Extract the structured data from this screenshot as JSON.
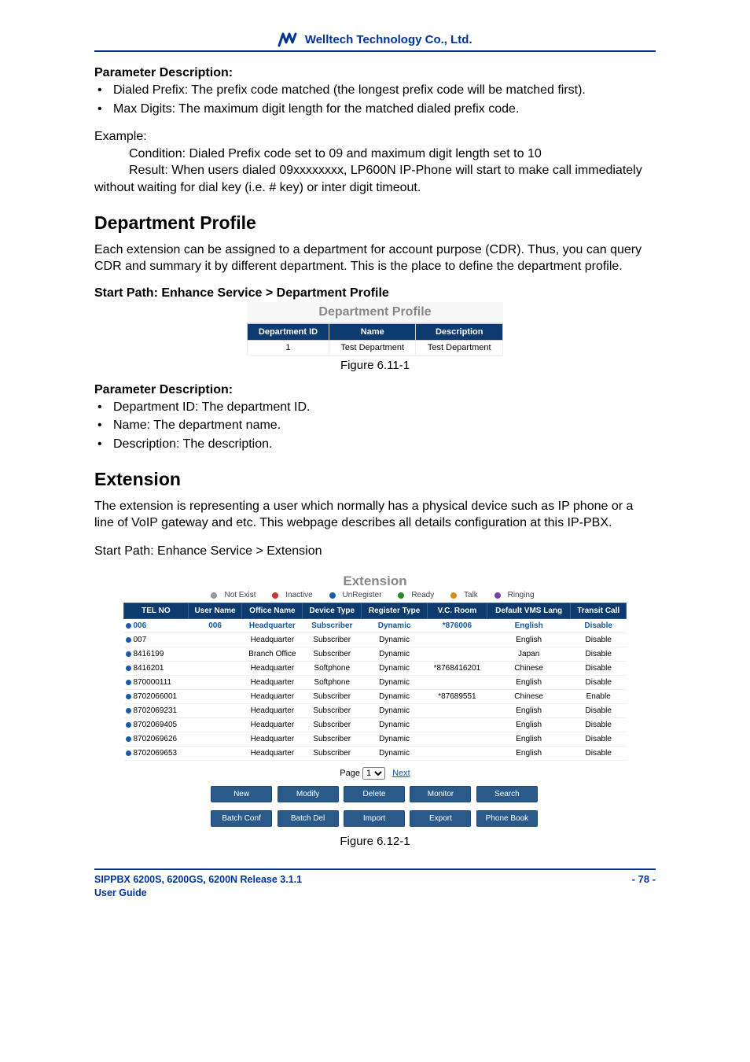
{
  "company": "Welltech Technology Co., Ltd.",
  "param_desc_head": "Parameter Description:",
  "param_desc1": [
    "Dialed Prefix: The prefix code matched (the longest prefix code will be matched first).",
    "Max Digits: The maximum digit length for the matched dialed prefix code."
  ],
  "example_head": "Example:",
  "example_line1": "Condition: Dialed Prefix code set to 09 and maximum digit length set to 10",
  "example_line2": "Result: When users dialed 09xxxxxxxx, LP600N IP-Phone will start to make call immediately without waiting for dial key (i.e. # key) or inter digit timeout.",
  "dept_profile_heading": "Department Profile",
  "dept_profile_text": "Each extension can be assigned to a department for account purpose (CDR). Thus, you can query CDR and summary it by different department. This is the place to define the department profile.",
  "dept_profile_path": "Start Path: Enhance Service > Department Profile",
  "dept_panel_title": "Department Profile",
  "dept_cols": [
    "Department ID",
    "Name",
    "Description"
  ],
  "dept_row": {
    "id": "1",
    "name": "Test Department",
    "desc": "Test Department"
  },
  "fig_611": "Figure 6.11-1",
  "param_desc2": [
    "Department ID: The department ID.",
    "Name: The department name.",
    "Description: The description."
  ],
  "ext_heading": "Extension",
  "ext_text": "The extension is representing a user which normally has a physical device such as IP phone or a line of VoIP gateway and etc. This webpage describes all details configuration at this IP-PBX.",
  "ext_path": "Start Path: Enhance Service > Extension",
  "ext_panel_title": "Extension",
  "legend": {
    "not_exist": "Not Exist",
    "inactive": "Inactive",
    "unregister": "UnRegister",
    "ready": "Ready",
    "talk": "Talk",
    "ringing": "Ringing"
  },
  "ext_cols": [
    "TEL NO",
    "User Name",
    "Office Name",
    "Device Type",
    "Register Type",
    "V.C. Room",
    "Default VMS Lang",
    "Transit Call"
  ],
  "ext_rows": [
    {
      "tel": "006",
      "dotColor": "#1a5aa8",
      "user": "006",
      "office": "Headquarter",
      "device": "Subscriber",
      "reg": "Dynamic",
      "vcroom": "*876006",
      "lang": "English",
      "transit": "Disable",
      "hl": true
    },
    {
      "tel": "007",
      "dotColor": "#1a5aa8",
      "user": "",
      "office": "Headquarter",
      "device": "Subscriber",
      "reg": "Dynamic",
      "vcroom": "",
      "lang": "English",
      "transit": "Disable",
      "hl": false
    },
    {
      "tel": "8416199",
      "dotColor": "#1a5aa8",
      "user": "",
      "office": "Branch Office",
      "device": "Subscriber",
      "reg": "Dynamic",
      "vcroom": "",
      "lang": "Japan",
      "transit": "Disable",
      "hl": false
    },
    {
      "tel": "8416201",
      "dotColor": "#1a5aa8",
      "user": "",
      "office": "Headquarter",
      "device": "Softphone",
      "reg": "Dynamic",
      "vcroom": "*8768416201",
      "lang": "Chinese",
      "transit": "Disable",
      "hl": false
    },
    {
      "tel": "870000111",
      "dotColor": "#1a5aa8",
      "user": "",
      "office": "Headquarter",
      "device": "Softphone",
      "reg": "Dynamic",
      "vcroom": "",
      "lang": "English",
      "transit": "Disable",
      "hl": false
    },
    {
      "tel": "8702066001",
      "dotColor": "#1a5aa8",
      "user": "",
      "office": "Headquarter",
      "device": "Subscriber",
      "reg": "Dynamic",
      "vcroom": "*87689551",
      "lang": "Chinese",
      "transit": "Enable",
      "hl": false
    },
    {
      "tel": "8702069231",
      "dotColor": "#1a5aa8",
      "user": "",
      "office": "Headquarter",
      "device": "Subscriber",
      "reg": "Dynamic",
      "vcroom": "",
      "lang": "English",
      "transit": "Disable",
      "hl": false
    },
    {
      "tel": "8702069405",
      "dotColor": "#1a5aa8",
      "user": "",
      "office": "Headquarter",
      "device": "Subscriber",
      "reg": "Dynamic",
      "vcroom": "",
      "lang": "English",
      "transit": "Disable",
      "hl": false
    },
    {
      "tel": "8702069626",
      "dotColor": "#1a5aa8",
      "user": "",
      "office": "Headquarter",
      "device": "Subscriber",
      "reg": "Dynamic",
      "vcroom": "",
      "lang": "English",
      "transit": "Disable",
      "hl": false
    },
    {
      "tel": "8702069653",
      "dotColor": "#1a5aa8",
      "user": "",
      "office": "Headquarter",
      "device": "Subscriber",
      "reg": "Dynamic",
      "vcroom": "",
      "lang": "English",
      "transit": "Disable",
      "hl": false
    }
  ],
  "pager": {
    "label": "Page",
    "value": "1",
    "next": "Next"
  },
  "buttons": [
    "New",
    "Modify",
    "Delete",
    "Monitor",
    "Search",
    "Batch Conf",
    "Batch Del",
    "Import",
    "Export",
    "Phone Book"
  ],
  "fig_612": "Figure 6.12-1",
  "footer_line1": "SIPPBX 6200S, 6200GS, 6200N Release 3.1.1",
  "footer_line2": "User Guide",
  "footer_page": "- 78 -"
}
